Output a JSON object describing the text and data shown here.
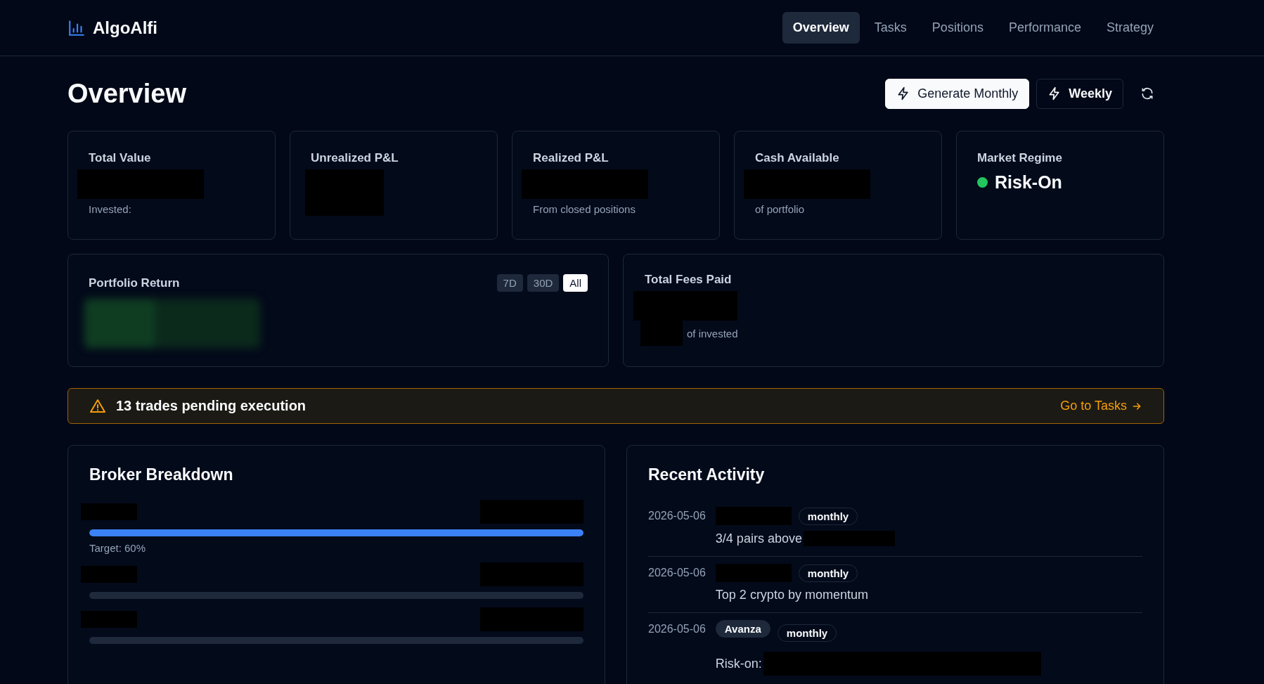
{
  "brand": {
    "name": "AlgoAlfi"
  },
  "nav": [
    {
      "label": "Overview",
      "selected": true
    },
    {
      "label": "Tasks",
      "selected": false
    },
    {
      "label": "Positions",
      "selected": false
    },
    {
      "label": "Performance",
      "selected": false
    },
    {
      "label": "Strategy",
      "selected": false
    }
  ],
  "page_title": "Overview",
  "actions": [
    {
      "label": "Generate Monthly",
      "kind": "primary"
    },
    {
      "label": "Weekly",
      "kind": "secondary"
    }
  ],
  "stats": [
    {
      "title": "Total Value",
      "kind": "value-note",
      "note": "Invested:"
    },
    {
      "title": "Unrealized P&L",
      "kind": "value"
    },
    {
      "title": "Realized P&L",
      "kind": "value-note",
      "note": "From closed positions"
    },
    {
      "title": "Cash Available",
      "kind": "value-note",
      "note": "of portfolio"
    },
    {
      "title": "Market Regime",
      "kind": "regime",
      "regime": "Risk-On",
      "color": "#22c55e"
    }
  ],
  "portfolio_return": {
    "title": "Portfolio Return",
    "ranges": [
      {
        "label": "7D",
        "selected": false
      },
      {
        "label": "30D",
        "selected": false
      },
      {
        "label": "All",
        "selected": true
      }
    ]
  },
  "fees": {
    "title": "Total Fees Paid",
    "note": "of invested"
  },
  "alert": {
    "message": "13 trades pending execution",
    "link": "Go to Tasks"
  },
  "broker_breakdown": {
    "title": "Broker Breakdown",
    "brokers": [
      {
        "level": 1,
        "target": "Target: 60%"
      },
      {
        "level": 0
      },
      {
        "level": 0
      }
    ]
  },
  "recent_activity": {
    "title": "Recent Activity",
    "items": [
      {
        "date": "2026-05-06",
        "strategy": "monthly",
        "description": "3/4 pairs above"
      },
      {
        "date": "2026-05-06",
        "strategy": "monthly",
        "description": "Top 2 crypto by momentum"
      },
      {
        "date": "2026-05-06",
        "broker": "Avanza",
        "strategy": "monthly",
        "description": "Risk-on:"
      }
    ]
  }
}
